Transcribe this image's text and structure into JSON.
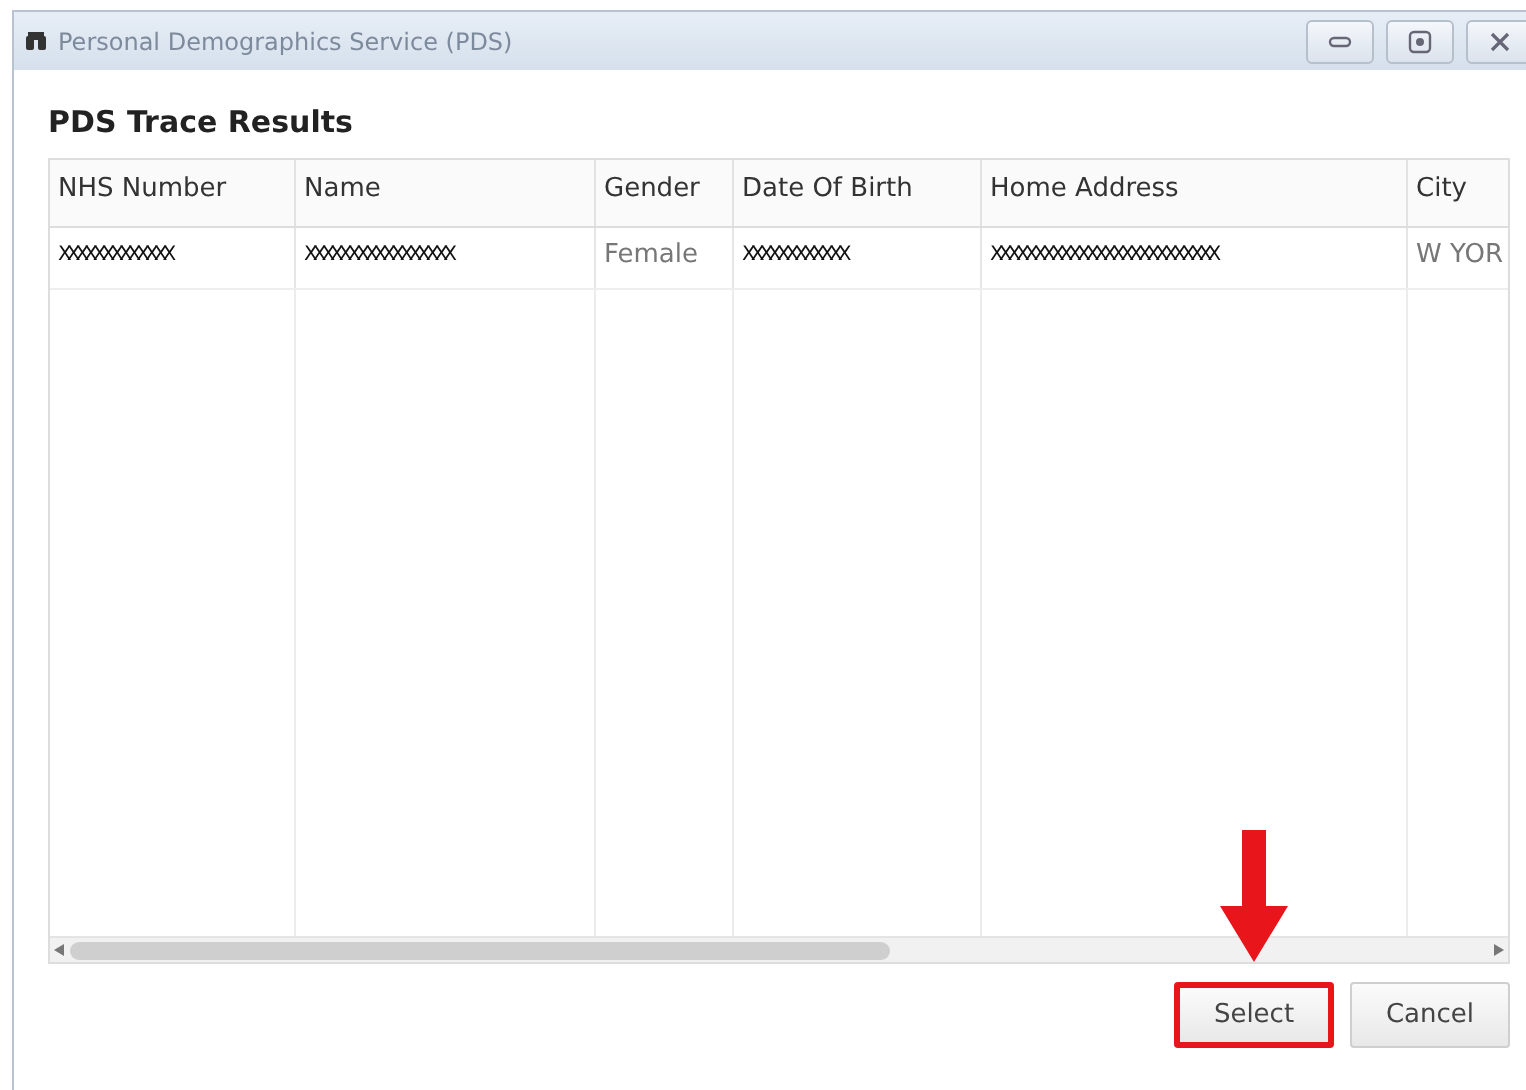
{
  "window": {
    "title": "Personal Demographics Service (PDS)"
  },
  "heading": "PDS Trace Results",
  "table": {
    "columns": [
      "NHS Number",
      "Name",
      "Gender",
      "Date Of Birth",
      "Home Address",
      "City"
    ],
    "rows": [
      {
        "selected": false,
        "cells": [
          "XXXXXXXXXXXXX",
          "XXXXXXXXXXXXXXXXX",
          "Female",
          "XXXXXXXXXXXX",
          "XXXXXXXXXXXXXXXXXXXXXXXXXX",
          "W YOR"
        ]
      }
    ]
  },
  "buttons": [
    {
      "label": "Select",
      "highlighted": true
    },
    {
      "label": "Cancel",
      "highlighted": false
    }
  ]
}
